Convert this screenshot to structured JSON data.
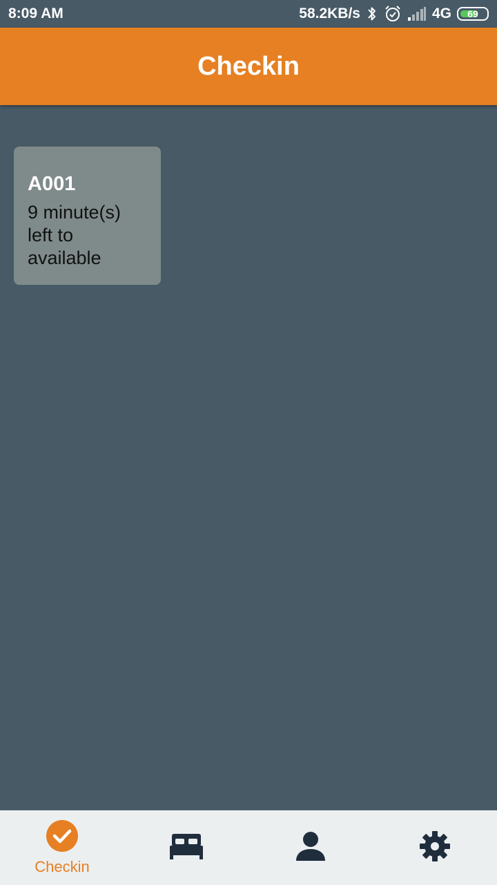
{
  "status_bar": {
    "time": "8:09 AM",
    "speed": "58.2KB/s",
    "network": "4G",
    "battery": "69",
    "battery_level": 0.69,
    "icons": [
      "bluetooth-icon",
      "alarm-icon",
      "signal-icon",
      "battery-icon"
    ]
  },
  "app_bar": {
    "title": "Checkin"
  },
  "rooms": [
    {
      "name": "A001",
      "status": "9 minute(s) left to available"
    }
  ],
  "bottom_nav": {
    "items": [
      {
        "label": "Checkin",
        "icon": "check-circle-icon",
        "active": true
      },
      {
        "label": "",
        "icon": "bed-icon",
        "active": false
      },
      {
        "label": "",
        "icon": "person-icon",
        "active": false
      },
      {
        "label": "",
        "icon": "gear-icon",
        "active": false
      }
    ]
  },
  "colors": {
    "accent": "#e68022",
    "background": "#475a66",
    "card": "#7f8b8a",
    "nav_background": "#eceff0",
    "nav_icon": "#1f2d3d",
    "battery": "#57c95a"
  }
}
